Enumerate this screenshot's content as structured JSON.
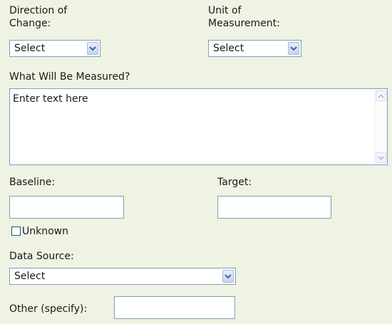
{
  "direction": {
    "label_line1": "Direction of",
    "label_line2": "Change:",
    "selected": "Select"
  },
  "unit": {
    "label_line1": "Unit of",
    "label_line2": "Measurement:",
    "selected": "Select"
  },
  "measured": {
    "label": "What Will Be Measured?",
    "value": "Enter text here"
  },
  "baseline": {
    "label": "Baseline:",
    "value": ""
  },
  "target": {
    "label": "Target:",
    "value": ""
  },
  "unknown": {
    "label": "Unknown",
    "checked": false
  },
  "data_source": {
    "label": "Data Source:",
    "selected": "Select"
  },
  "other": {
    "label": "Other (specify):",
    "value": ""
  },
  "icons": {
    "dropdown": "chevron-down-icon",
    "scroll_up": "scroll-up-arrow-icon",
    "scroll_down": "scroll-down-arrow-icon"
  },
  "colors": {
    "background": "#eef3e3",
    "border": "#7f9db9",
    "arrow": "#4d6185"
  }
}
